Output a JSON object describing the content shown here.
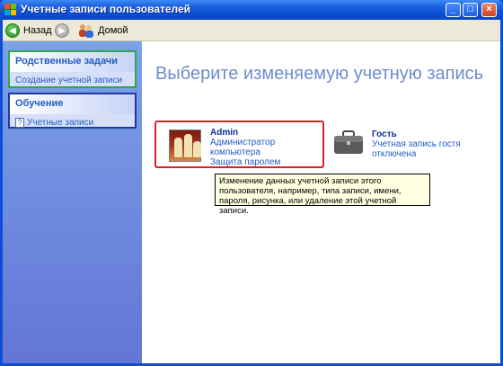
{
  "window": {
    "title": "Учетные записи пользователей",
    "controls": {
      "minimize": "_",
      "maximize": "□",
      "close": "×"
    }
  },
  "toolbar": {
    "back_label": "Назад",
    "home_label": "Домой"
  },
  "taskpane": {
    "related": {
      "header": "Родственные задачи",
      "items": [
        "Создание учетной записи"
      ]
    },
    "learn": {
      "header": "Обучение",
      "items": [
        "Учетные записи"
      ]
    }
  },
  "main": {
    "title": "Выберите изменяемую учетную запись",
    "accounts": [
      {
        "name": "Admin",
        "line1": "Администратор компьютера",
        "line2": "Защита паролем",
        "icon": "chess-pieces-picture"
      },
      {
        "name": "Гость",
        "line1": "Учетная запись гостя",
        "line2": "отключена",
        "icon": "briefcase-icon"
      }
    ],
    "tooltip": "Изменение данных учетной записи этого пользователя, например, типа записи, имени, пароля, рисунка, или удаление этой учетной записи."
  },
  "colors": {
    "title_bar": "#0a4fd6",
    "task_pane": "#6375d6",
    "related_border": "#2ea84a",
    "learn_border": "#1f3a9b",
    "selected_border": "#d2262b",
    "heading_text": "#6d8cd0"
  }
}
